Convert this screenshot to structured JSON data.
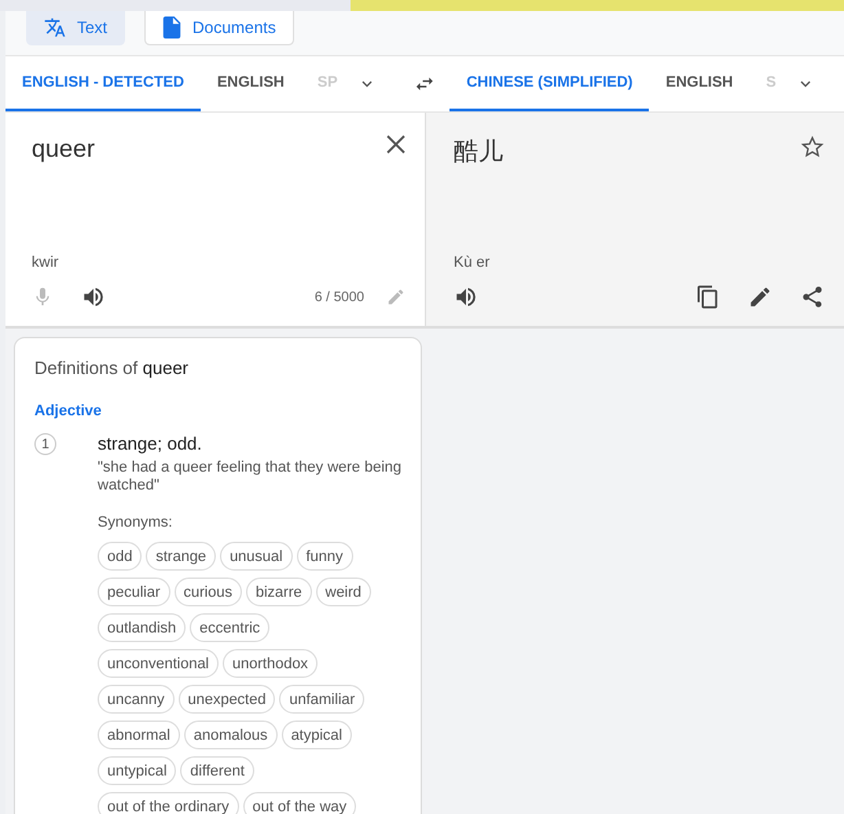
{
  "modes": [
    {
      "label": "Text",
      "kind": "translate",
      "selected": true
    },
    {
      "label": "Documents",
      "kind": "document",
      "selected": false
    }
  ],
  "source_tabs": [
    {
      "label": "ENGLISH - DETECTED",
      "selected": true,
      "faded": false
    },
    {
      "label": "ENGLISH",
      "selected": false,
      "faded": false
    },
    {
      "label": "SP",
      "selected": false,
      "faded": true
    }
  ],
  "target_tabs": [
    {
      "label": "CHINESE (SIMPLIFIED)",
      "selected": true,
      "faded": false
    },
    {
      "label": "ENGLISH",
      "selected": false,
      "faded": false
    },
    {
      "label": "S",
      "selected": false,
      "faded": true
    }
  ],
  "source": {
    "text": "queer",
    "transliteration": "kwir",
    "counter": "6 / 5000"
  },
  "target": {
    "text": "酷儿",
    "transliteration": "Kù er"
  },
  "definitions": {
    "title": "Definitions of **queer**",
    "part_of_speech": "Adjective",
    "senses": [
      {
        "number": "1",
        "meaning": "strange; odd.",
        "example": "\"she had a queer feeling that they were being watched\"",
        "synonyms_label": "Synonyms:",
        "synonym_rows": [
          [
            "odd",
            "strange",
            "unusual",
            "funny"
          ],
          [
            "peculiar",
            "curious",
            "bizarre",
            "weird"
          ],
          [
            "outlandish",
            "eccentric"
          ],
          [
            "unconventional",
            "unorthodox"
          ],
          [
            "uncanny",
            "unexpected",
            "unfamiliar"
          ],
          [
            "abnormal",
            "anomalous",
            "atypical"
          ],
          [
            "untypical",
            "different"
          ],
          [
            "out of the ordinary",
            "out of the way"
          ]
        ]
      }
    ]
  }
}
